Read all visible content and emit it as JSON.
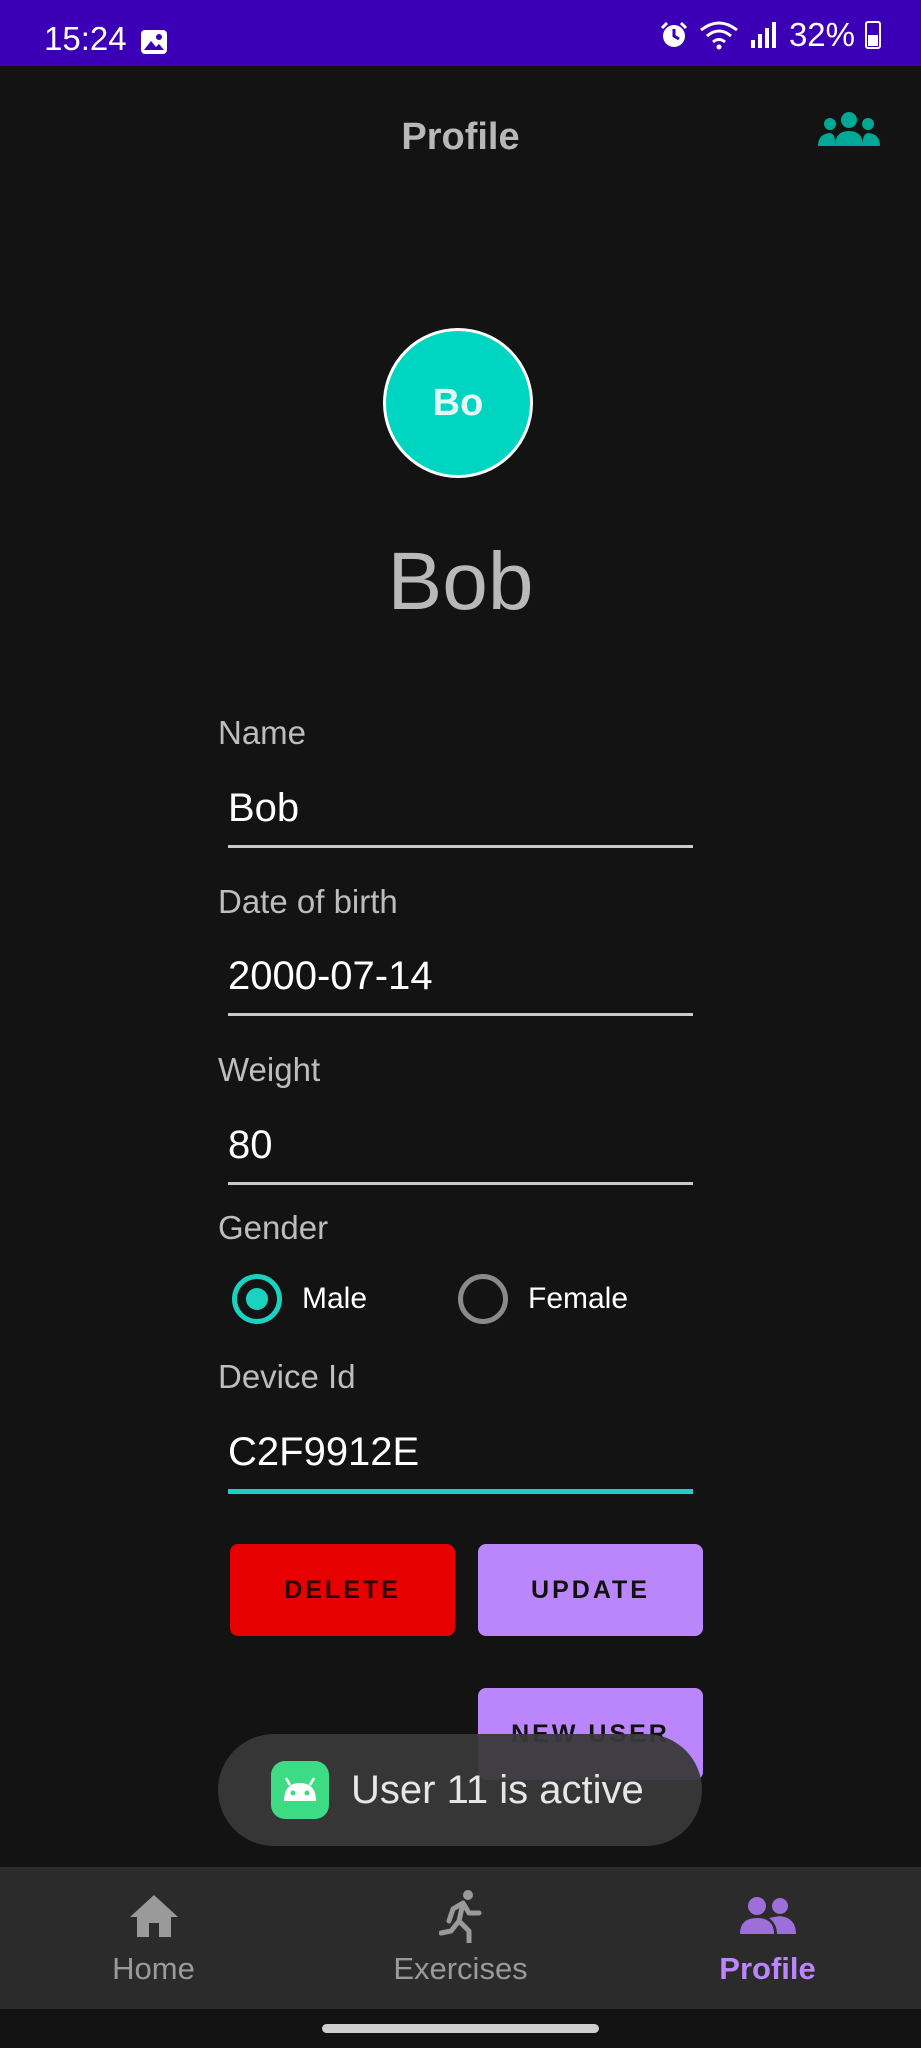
{
  "status_bar": {
    "time": "15:24",
    "battery": "32%",
    "icons": [
      "gallery-icon",
      "alarm-icon",
      "wifi-icon",
      "signal-icon",
      "battery-icon"
    ]
  },
  "app_bar": {
    "title": "Profile",
    "action_icon": "users-icon"
  },
  "profile": {
    "avatar_initials": "Bo",
    "display_name": "Bob"
  },
  "form": {
    "name": {
      "label": "Name",
      "value": "Bob"
    },
    "dob": {
      "label": "Date of birth",
      "value": "2000-07-14"
    },
    "weight": {
      "label": "Weight",
      "value": "80"
    },
    "gender": {
      "label": "Gender",
      "options": [
        {
          "label": "Male",
          "checked": true
        },
        {
          "label": "Female",
          "checked": false
        }
      ]
    },
    "device": {
      "label": "Device Id",
      "value": "C2F9912E"
    }
  },
  "buttons": {
    "delete": "DELETE",
    "update": "UPDATE",
    "new_user": "NEW USER"
  },
  "toast": {
    "text": "User 11 is active",
    "icon": "android-icon"
  },
  "bottom_nav": {
    "items": [
      {
        "label": "Home",
        "icon": "home-icon"
      },
      {
        "label": "Exercises",
        "icon": "running-icon"
      },
      {
        "label": "Profile",
        "icon": "people-icon",
        "selected": true
      }
    ]
  },
  "colors": {
    "status_bar": "#3b00b6",
    "accent_teal": "#19d3c0",
    "avatar": "#00d5c1",
    "purple": "#bb86fc",
    "delete_red": "#e60000",
    "background": "#131313"
  }
}
